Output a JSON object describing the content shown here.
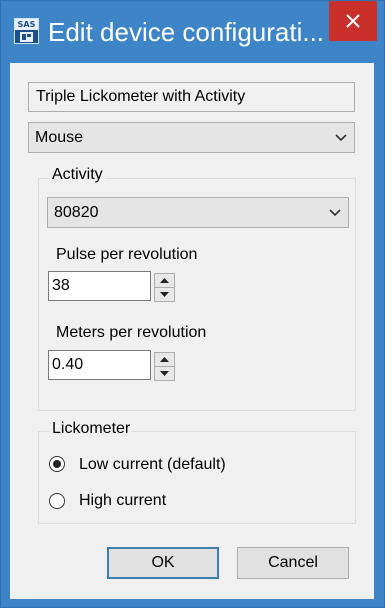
{
  "window": {
    "title": "Edit device configurati...",
    "icon_text": "SAS",
    "close_icon": "close-icon"
  },
  "device_name": {
    "value": "Triple Lickometer with Activity"
  },
  "species_select": {
    "selected": "Mouse"
  },
  "activity_group": {
    "legend": "Activity",
    "model_select": {
      "selected": "80820"
    },
    "pulse_label": "Pulse per revolution",
    "pulse_value": "38",
    "meters_label": "Meters per revolution",
    "meters_value": "0.40"
  },
  "lickometer_group": {
    "legend": "Lickometer",
    "options": [
      {
        "label": "Low current (default)",
        "selected": true
      },
      {
        "label": "High current",
        "selected": false
      }
    ]
  },
  "buttons": {
    "ok": "OK",
    "cancel": "Cancel"
  },
  "colors": {
    "titlebar": "#3d85c6",
    "close_button": "#c7302b",
    "dialog_bg": "#f0f0f0",
    "default_button_border": "#3c7fb1"
  }
}
